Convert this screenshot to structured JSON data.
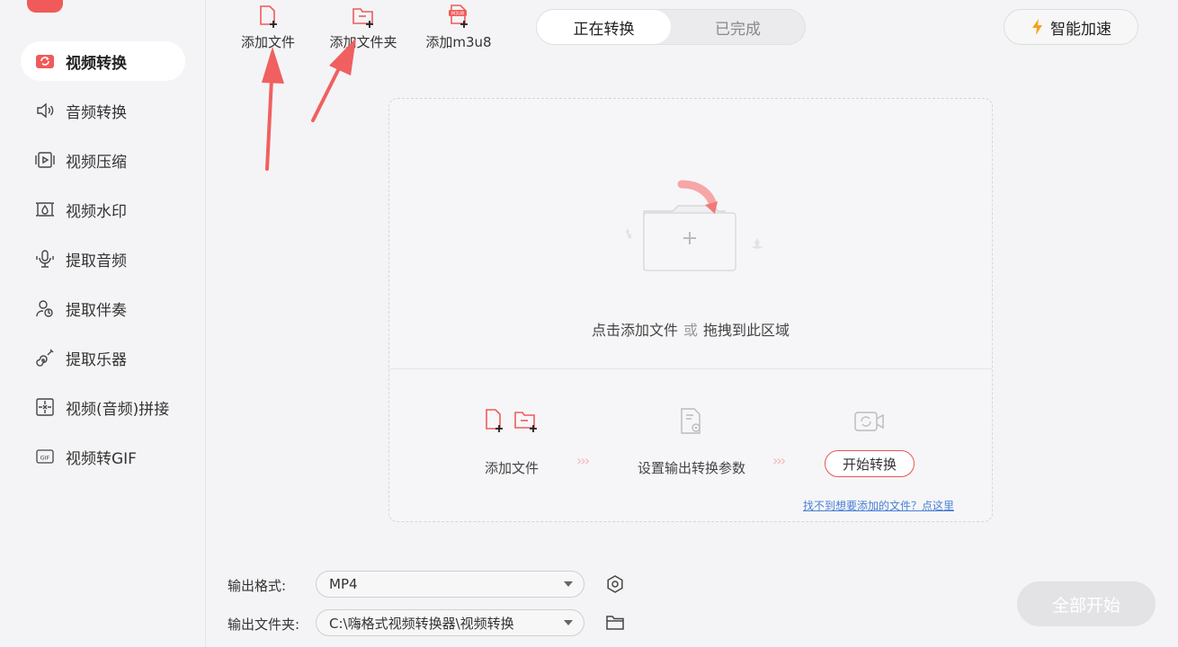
{
  "sidebar": {
    "items": [
      {
        "label": "视频转换",
        "icon": "video-convert-icon"
      },
      {
        "label": "音频转换",
        "icon": "speaker-icon"
      },
      {
        "label": "视频压缩",
        "icon": "video-compress-icon"
      },
      {
        "label": "视频水印",
        "icon": "watermark-icon"
      },
      {
        "label": "提取音频",
        "icon": "microphone-icon"
      },
      {
        "label": "提取伴奏",
        "icon": "singer-icon"
      },
      {
        "label": "提取乐器",
        "icon": "guitar-icon"
      },
      {
        "label": "视频(音频)拼接",
        "icon": "splice-icon"
      },
      {
        "label": "视频转GIF",
        "icon": "gif-icon"
      }
    ]
  },
  "toolbar": {
    "add_file": "添加文件",
    "add_folder": "添加文件夹",
    "add_m3u8": "添加m3u8",
    "m3u8_badge": "M3U8"
  },
  "tabs": {
    "converting": "正在转换",
    "completed": "已完成"
  },
  "speed_label": "智能加速",
  "dropzone": {
    "hint_main": "点击添加文件",
    "hint_or": "或",
    "hint_drag": "拖拽到此区域",
    "step1": "添加文件",
    "step2": "设置输出转换参数",
    "step3": "开始转换",
    "help_link": "找不到想要添加的文件？点这里"
  },
  "footer": {
    "format_label": "输出格式:",
    "format_value": "MP4",
    "folder_label": "输出文件夹:",
    "folder_value": "C:\\嗨格式视频转换器\\视频转换",
    "start_all": "全部开始"
  },
  "colors": {
    "accent": "#f05a5a",
    "link": "#4a7fd6",
    "annotation_arrow": "#f06060"
  }
}
